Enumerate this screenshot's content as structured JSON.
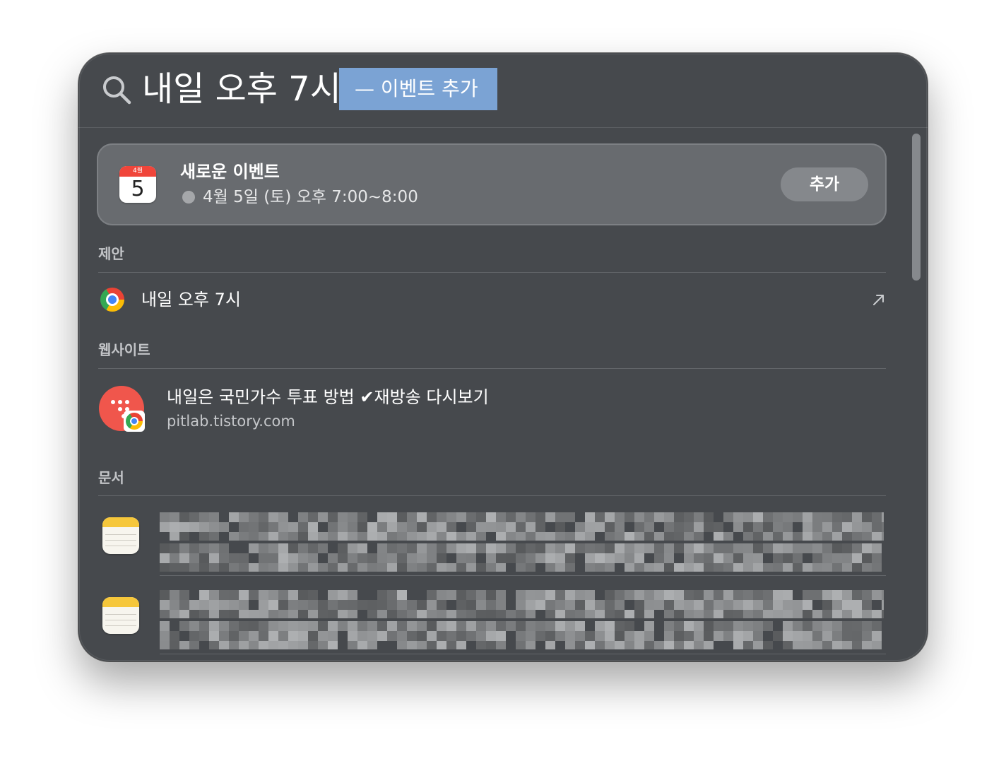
{
  "search": {
    "query": "내일 오후 7시",
    "completion": "—  이벤트 추가"
  },
  "event_card": {
    "calendar_month": "4월",
    "calendar_day": "5",
    "title": "새로운 이벤트",
    "time": "4월 5일 (토) 오후 7:00~8:00",
    "add_label": "추가"
  },
  "sections": {
    "suggestions": "제안",
    "websites": "웹사이트",
    "documents": "문서"
  },
  "suggestion": {
    "label": "내일 오후 7시"
  },
  "website": {
    "title": "내일은 국민가수 투표 방법 ✔재방송 다시보기",
    "url": "pitlab.tistory.com"
  },
  "colors": {
    "window_bg": "#46494d",
    "completion_highlight": "#7ba3d4",
    "calendar_red": "#f0453a",
    "site_logo": "#f0564c",
    "notes_yellow": "#f6c73b"
  },
  "icons": [
    "search-icon",
    "calendar-icon",
    "chrome-icon",
    "open-arrow-icon",
    "notes-icon"
  ]
}
